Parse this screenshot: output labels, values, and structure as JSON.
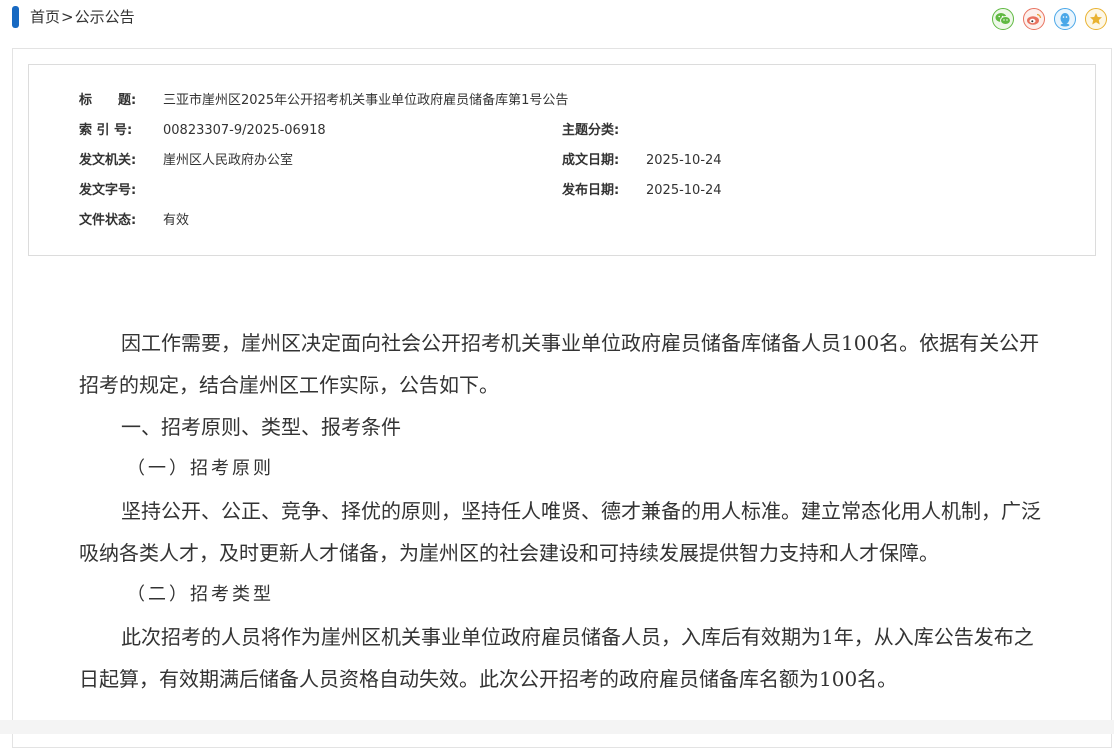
{
  "breadcrumb": {
    "home": "首页",
    "separator": ">",
    "current": "公示公告"
  },
  "share": [
    {
      "name": "wechat-icon",
      "color": "#5fb941"
    },
    {
      "name": "weibo-icon",
      "color": "#e8725f"
    },
    {
      "name": "qq-icon",
      "color": "#4aa7e8"
    },
    {
      "name": "favorite-icon",
      "color": "#e9b230"
    }
  ],
  "meta": {
    "title_label": "标　　题:",
    "title_value": "三亚市崖州区2025年公开招考机关事业单位政府雇员储备库第1号公告",
    "index_label": "索 引 号:",
    "index_value": "00823307-9/2025-06918",
    "topic_label": "主题分类:",
    "topic_value": "",
    "issuer_label": "发文机关:",
    "issuer_value": "崖州区人民政府办公室",
    "written_label": "成文日期:",
    "written_value": "2025-10-24",
    "docno_label": "发文字号:",
    "docno_value": "",
    "published_label": "发布日期:",
    "published_value": "2025-10-24",
    "status_label": "文件状态:",
    "status_value": "有效"
  },
  "content": {
    "p1": "因工作需要，崖州区决定面向社会公开招考机关事业单位政府雇员储备库储备人员100名。依据有关公开招考的规定，结合崖州区工作实际，公告如下。",
    "h1": "一、招考原则、类型、报考条件",
    "h2a": "（一）招考原则",
    "p2": "坚持公开、公正、竞争、择优的原则，坚持任人唯贤、德才兼备的用人标准。建立常态化用人机制，广泛吸纳各类人才，及时更新人才储备，为崖州区的社会建设和可持续发展提供智力支持和人才保障。",
    "h2b": "（二）招考类型",
    "p3": "此次招考的人员将作为崖州区机关事业单位政府雇员储备人员，入库后有效期为1年，从入库公告发布之日起算，有效期满后储备人员资格自动失效。此次公开招考的政府雇员储备库名额为100名。"
  }
}
